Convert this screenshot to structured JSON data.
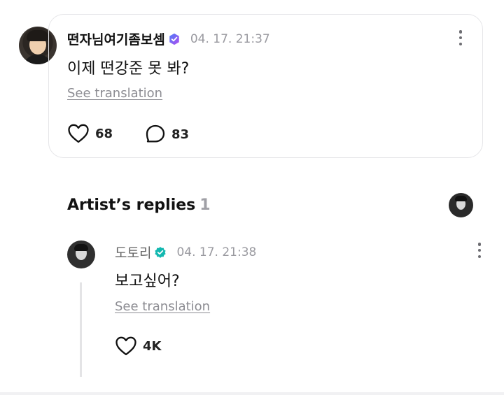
{
  "post": {
    "author": "떤자님여기좀보셈",
    "timestamp": "04. 17. 21:37",
    "text": "이제 떤강준 못 봐?",
    "translate_label": "See translation",
    "likes": "68",
    "comments": "83"
  },
  "artist_replies": {
    "title": "Artist’s replies",
    "count": "1",
    "reply": {
      "author": "도토리",
      "timestamp": "04. 17. 21:38",
      "text": "보고싶어?",
      "translate_label": "See translation",
      "likes": "4K"
    }
  },
  "colors": {
    "fan_badge": "#7b5cf0",
    "artist_badge": "#13b8b0",
    "muted_text": "#9a9aa0",
    "card_border": "#e5e5e8"
  },
  "icons": [
    "heart-icon",
    "comment-icon",
    "more-options-icon",
    "fan-verified-badge-icon",
    "artist-verified-badge-icon"
  ]
}
